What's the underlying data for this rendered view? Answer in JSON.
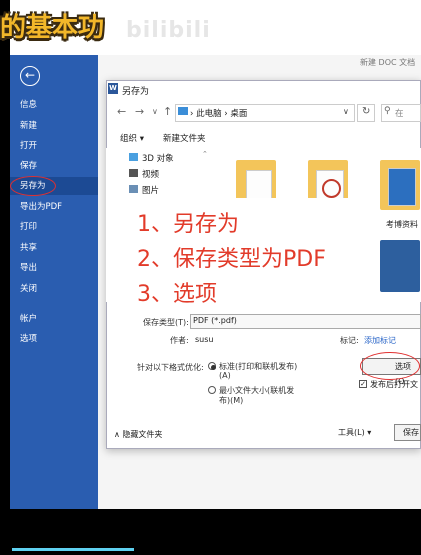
{
  "overlay": {
    "caption": "的基本功",
    "watermark": "bilibili",
    "notes": [
      "1、另存为",
      "2、保存类型为PDF",
      "3、选项"
    ]
  },
  "backstage": {
    "back_icon": "←",
    "items": [
      {
        "label": "信息"
      },
      {
        "label": "新建"
      },
      {
        "label": "打开"
      },
      {
        "label": "保存"
      },
      {
        "label": "另存为"
      },
      {
        "label": "导出为PDF"
      },
      {
        "label": "打印"
      },
      {
        "label": "共享"
      },
      {
        "label": "导出"
      },
      {
        "label": "关闭"
      },
      {
        "label": "帐户"
      },
      {
        "label": "选项"
      }
    ],
    "doc_title": "新建 DOC 文档"
  },
  "dialog": {
    "title": "另存为",
    "nav": {
      "back": "←",
      "forward": "→",
      "down": "∨",
      "up": "↑",
      "refresh": "↻"
    },
    "path": "› 此电脑 › 桌面",
    "search_placeholder": "在",
    "toolbar": {
      "organize": "组织 ▾",
      "new_folder": "新建文件夹"
    },
    "tree": [
      {
        "label": "3D 对象"
      },
      {
        "label": "视频"
      },
      {
        "label": "图片"
      }
    ],
    "file_label": "考博资料",
    "form": {
      "type_label": "保存类型(T):",
      "type_value": "PDF (*.pdf)",
      "author_label": "作者:",
      "author_value": "susu",
      "tag_label": "标记:",
      "tag_value": "添加标记",
      "optimize_label": "针对以下格式优化:",
      "option1_line1": "标准(打印和联机发布)",
      "option1_line2": "(A)",
      "option2_line1": "最小文件大小(联机发",
      "option2_line2": "布)(M)",
      "options_button": "选项(O",
      "publish_open": "发布后打开文",
      "check_mark": "✓"
    },
    "footer": {
      "hide_folders": "∧ 隐藏文件夹",
      "tools": "工具(L)  ▾",
      "save": "保存"
    }
  }
}
